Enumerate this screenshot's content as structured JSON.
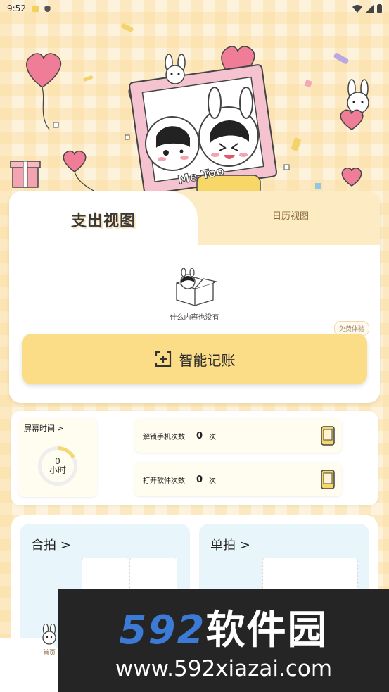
{
  "status_bar": {
    "time": "9:52"
  },
  "hero": {
    "frame_caption": "Me Too"
  },
  "main_card": {
    "tabs": [
      {
        "label": "支出视图",
        "active": true
      },
      {
        "label": "日历视图",
        "active": false
      }
    ],
    "empty_state": "什么内容也没有",
    "smart_button_label": "智能记账",
    "trial_badge": "免费体验"
  },
  "screen_time": {
    "title": "屏幕时间 >",
    "value": "0",
    "unit": "小时",
    "progress_percent": 17,
    "stats": [
      {
        "label": "解锁手机次数",
        "value": "0",
        "unit": "次"
      },
      {
        "label": "打开软件次数",
        "value": "0",
        "unit": "次"
      }
    ]
  },
  "photo": {
    "panels": [
      {
        "title": "合拍 >"
      },
      {
        "title": "单拍 >"
      }
    ]
  },
  "bottom_nav": {
    "home_label": "首页"
  },
  "watermark": {
    "brand_num": "592",
    "brand_cn": "软件园",
    "url": "www.592xiazai.com"
  },
  "colors": {
    "accent": "#fbdc87",
    "tab_bg": "#fdebc4",
    "photo_bg": "#e8f6fb",
    "ring": "#f6d778"
  }
}
